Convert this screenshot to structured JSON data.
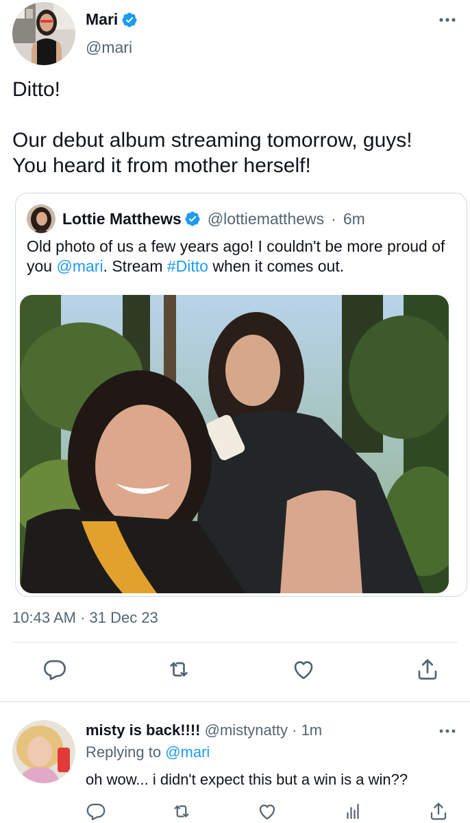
{
  "tweet": {
    "author_name": "Mari",
    "author_handle": "@mari",
    "text_line1": "Ditto!",
    "text_line2": "Our debut album streaming tomorrow, guys!",
    "text_line3": "You heard it from mother herself!",
    "timestamp": "10:43 AM · 31 Dec 23"
  },
  "quote": {
    "author_name": "Lottie Matthews",
    "author_handle": "@lottiematthews",
    "separator": "·",
    "time": "6m",
    "text_part1": "Old photo of us a few years ago! I couldn't be more proud of you ",
    "mention": "@mari",
    "text_part2": ". Stream ",
    "hashtag": "#Ditto",
    "text_part3": " when it comes out."
  },
  "actions": [
    "reply-icon",
    "retweet-icon",
    "like-icon",
    "share-icon"
  ],
  "reply": {
    "author_name": "misty is back!!!!",
    "author_handle": "@mistynatty",
    "separator": "·",
    "time": "1m",
    "replying_prefix": "Replying to ",
    "replying_to": "@mari",
    "text": "oh wow... i didn't expect this but a win is a win??",
    "actions": [
      "reply-icon",
      "retweet-icon",
      "like-icon",
      "analytics-icon",
      "share-icon"
    ]
  },
  "colors": {
    "accent": "#1d9bf0",
    "text_primary": "#0f1419",
    "text_secondary": "#536471",
    "border": "#cfd9de"
  }
}
